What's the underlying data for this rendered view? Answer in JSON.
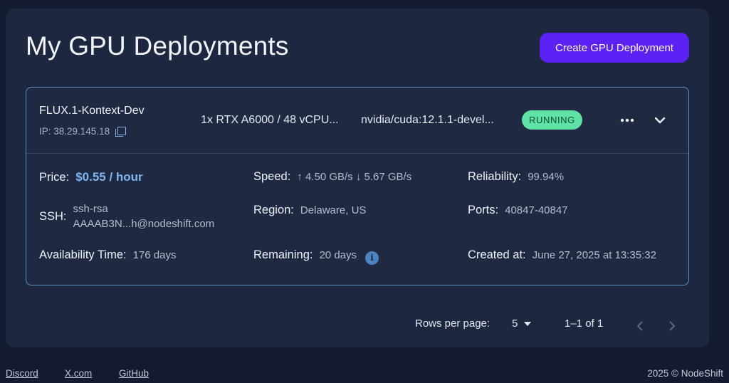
{
  "page": {
    "title": "My GPU Deployments",
    "create_button": "Create GPU Deployment"
  },
  "deployment": {
    "name": "FLUX.1-Kontext-Dev",
    "ip": "IP: 38.29.145.18",
    "gpu": "1x RTX A6000 / 48 vCPU...",
    "image": "nvidia/cuda:12.1.1-devel...",
    "status": "RUNNING",
    "status_color": "#5ee3a4",
    "details": {
      "price_label": "Price:",
      "price_value": "$0.55 / hour",
      "speed_label": "Speed:",
      "speed_value": "↑ 4.50 GB/s ↓ 5.67 GB/s",
      "reliability_label": "Reliability:",
      "reliability_value": "99.94%",
      "ssh_label": "SSH:",
      "ssh_line1": "ssh-rsa",
      "ssh_line2": "AAAAB3N...h@nodeshift.com",
      "region_label": "Region:",
      "region_value": "Delaware, US",
      "ports_label": "Ports:",
      "ports_value": "40847-40847",
      "availability_label": "Availability Time:",
      "availability_value": "176 days",
      "remaining_label": "Remaining:",
      "remaining_value": "20 days",
      "created_label": "Created at:",
      "created_value": "June 27, 2025 at 13:35:32"
    }
  },
  "pagination": {
    "rows_label": "Rows per page:",
    "rows_value": "5",
    "range": "1–1 of 1"
  },
  "footer": {
    "discord": "Discord",
    "x": "X.com",
    "github": "GitHub",
    "copyright": "2025 © NodeShift"
  },
  "colors": {
    "accent": "#5b21f5",
    "link": "#7fb6ef",
    "card_border": "#5d93c8"
  }
}
